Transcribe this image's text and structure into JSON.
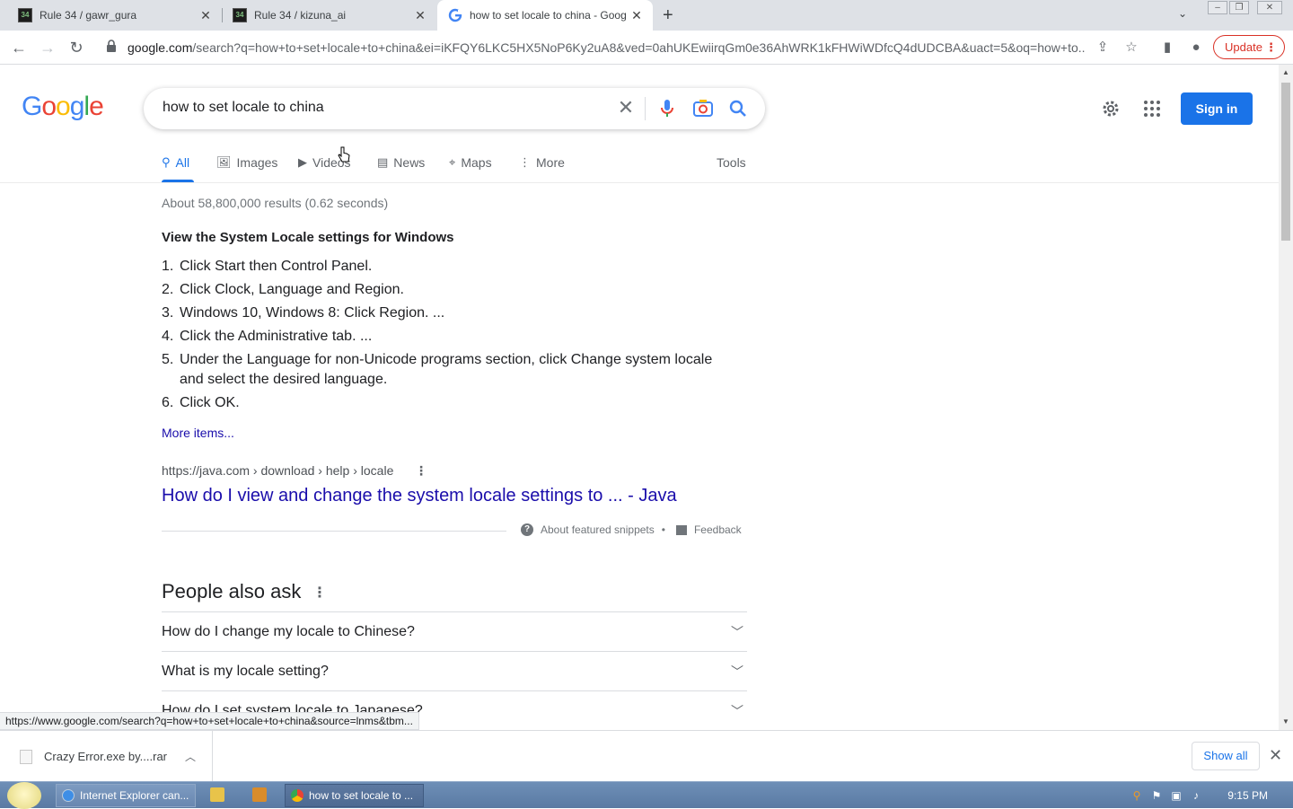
{
  "browser": {
    "tabs": [
      {
        "title": "Rule 34 / gawr_gura",
        "favicon": "r34-icon",
        "active": false
      },
      {
        "title": "Rule 34 / kizuna_ai",
        "favicon": "r34-icon",
        "active": false
      },
      {
        "title": "how to set locale to china - Goog",
        "favicon": "google-icon",
        "active": true
      }
    ],
    "url_host": "google.com",
    "url_path": "/search?q=how+to+set+locale+to+china&ei=iKFQY6LKC5HX5NoP6Ky2uA8&ved=0ahUKEwiirqGm0e36AhWRK1kFHWiWDfcQ4dUDCBA&uact=5&oq=how+to...",
    "update_label": "Update"
  },
  "google": {
    "logo": "Google",
    "query": "how to set locale to china",
    "sign_in": "Sign in",
    "tabs": [
      {
        "label": "All",
        "icon": "search-icon"
      },
      {
        "label": "Images",
        "icon": "image-icon"
      },
      {
        "label": "Videos",
        "icon": "video-icon"
      },
      {
        "label": "News",
        "icon": "news-icon"
      },
      {
        "label": "Maps",
        "icon": "map-pin-icon"
      },
      {
        "label": "More",
        "icon": "more-vert-icon"
      }
    ],
    "tools": "Tools",
    "result_stats": "About 58,800,000 results (0.62 seconds)",
    "snippet": {
      "heading": "View the System Locale settings for Windows",
      "steps": [
        {
          "num": "1.",
          "text": "Click Start then Control Panel."
        },
        {
          "num": "2.",
          "text": "Click Clock, Language and Region."
        },
        {
          "num": "3.",
          "text": "Windows 10, Windows 8: Click Region. ..."
        },
        {
          "num": "4.",
          "text": "Click the Administrative tab. ..."
        },
        {
          "num": "5.",
          "text": "Under the Language for non-Unicode programs section, click Change system locale and select the desired language."
        },
        {
          "num": "6.",
          "text": "Click OK."
        }
      ],
      "more_items": "More items...",
      "cite": "https://java.com › download › help › locale",
      "title": "How do I view and change the system locale settings to ... - Java",
      "about": "About featured snippets",
      "separator": "•",
      "feedback": "Feedback"
    },
    "paa": {
      "title": "People also ask",
      "questions": [
        "How do I change my locale to Chinese?",
        "What is my locale setting?",
        "How do I set system locale to Japanese?"
      ]
    },
    "status_url": "https://www.google.com/search?q=how+to+set+locale+to+china&source=lnms&tbm..."
  },
  "downloads": {
    "file": "Crazy Error.exe by....rar",
    "show_all": "Show all"
  },
  "taskbar": {
    "items": [
      {
        "label": "Internet Explorer can...",
        "icon": "ie-icon"
      },
      {
        "label": "how to set locale to ...",
        "icon": "chrome-icon"
      }
    ],
    "clock": "9:15 PM"
  },
  "colors": {
    "link": "#1a0dab",
    "accent": "#1a73e8",
    "update": "#d93025"
  }
}
